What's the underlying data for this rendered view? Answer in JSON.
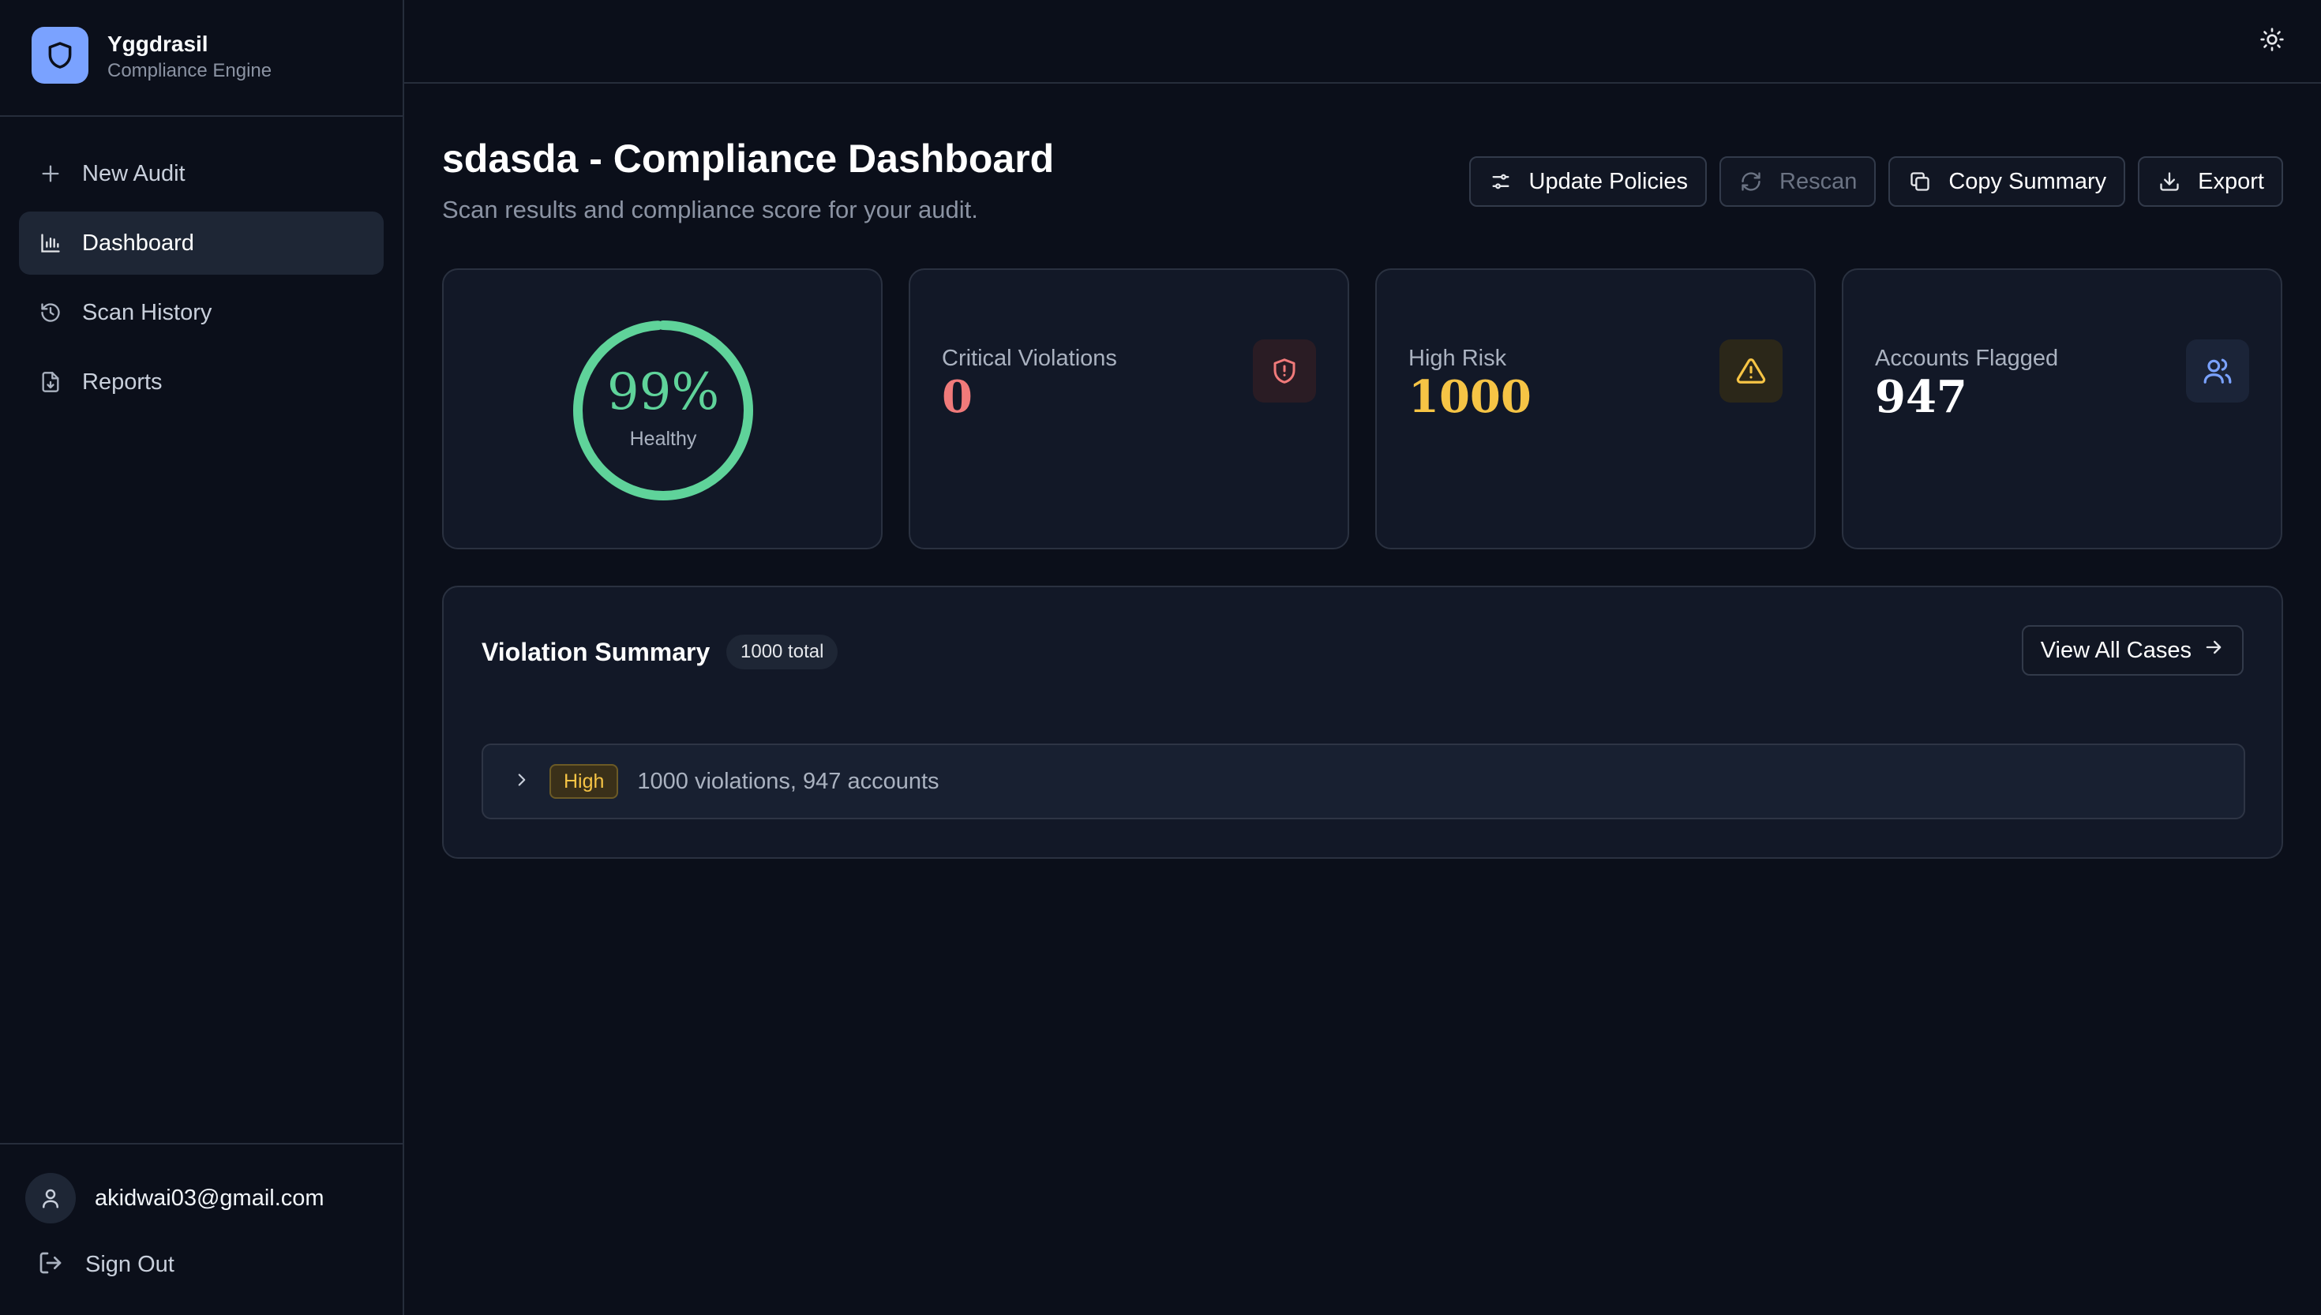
{
  "brand": {
    "name": "Yggdrasil",
    "subtitle": "Compliance Engine"
  },
  "nav": {
    "items": [
      {
        "label": "New Audit",
        "icon": "plus-icon",
        "active": false
      },
      {
        "label": "Dashboard",
        "icon": "bar-chart-icon",
        "active": true
      },
      {
        "label": "Scan History",
        "icon": "history-icon",
        "active": false
      },
      {
        "label": "Reports",
        "icon": "file-download-icon",
        "active": false
      }
    ]
  },
  "user": {
    "email": "akidwai03@gmail.com",
    "sign_out": "Sign Out"
  },
  "header": {
    "theme_icon": "sun-icon"
  },
  "page": {
    "title": "sdasda - Compliance Dashboard",
    "subtitle": "Scan results and compliance score for your audit."
  },
  "actions": {
    "update_policies": "Update Policies",
    "rescan": "Rescan",
    "copy_summary": "Copy Summary",
    "export": "Export"
  },
  "score": {
    "value": "99%",
    "label": "Healthy",
    "percent": 99,
    "color": "#5fd39a"
  },
  "stats": {
    "critical": {
      "label": "Critical Violations",
      "value": "0",
      "color": "#f07a7a",
      "icon": "shield-alert-icon"
    },
    "high": {
      "label": "High Risk",
      "value": "1000",
      "color": "#f6c445",
      "icon": "alert-triangle-icon"
    },
    "accounts": {
      "label": "Accounts Flagged",
      "value": "947",
      "color": "#ffffff",
      "icon": "users-icon"
    }
  },
  "summary": {
    "title": "Violation Summary",
    "total_badge": "1000 total",
    "view_all": "View All Cases",
    "rows": [
      {
        "severity": "High",
        "text": "1000 violations, 947 accounts"
      }
    ]
  }
}
